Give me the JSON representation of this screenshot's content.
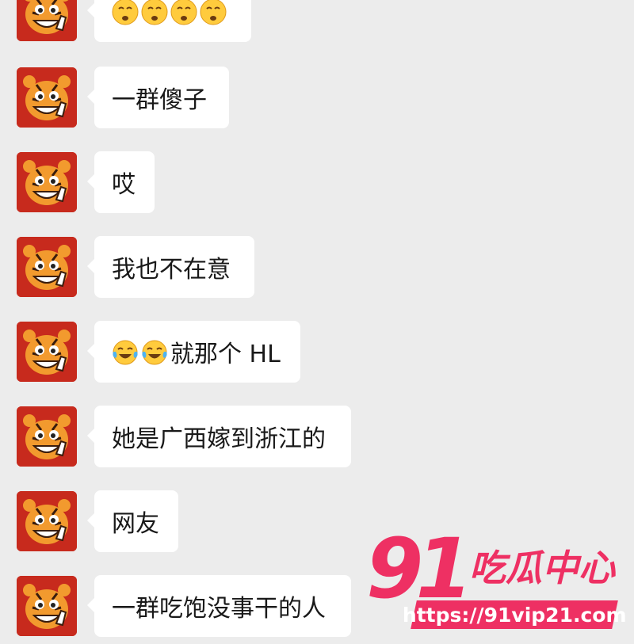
{
  "chat": {
    "messages": [
      {
        "text": "",
        "emojis": [
          "shush-face",
          "shush-face",
          "shush-face",
          "shush-face"
        ]
      },
      {
        "text": "一群傻子",
        "emojis": []
      },
      {
        "text": "哎",
        "emojis": []
      },
      {
        "text": "我也不在意",
        "emojis": []
      },
      {
        "text": "就那个 HL",
        "emojis": [
          "tears-of-joy",
          "tears-of-joy"
        ]
      },
      {
        "text": "她是广西嫁到浙江的",
        "emojis": []
      },
      {
        "text": "网友",
        "emojis": []
      },
      {
        "text": "一群吃饱没事干的人",
        "emojis": []
      }
    ]
  },
  "watermark": {
    "number": "91",
    "title": "吃瓜中心",
    "url": "https://91vip21.com"
  },
  "colors": {
    "background": "#ececec",
    "bubble": "#ffffff",
    "avatar_bg": "#c72a1d",
    "watermark": "#ee3063"
  }
}
